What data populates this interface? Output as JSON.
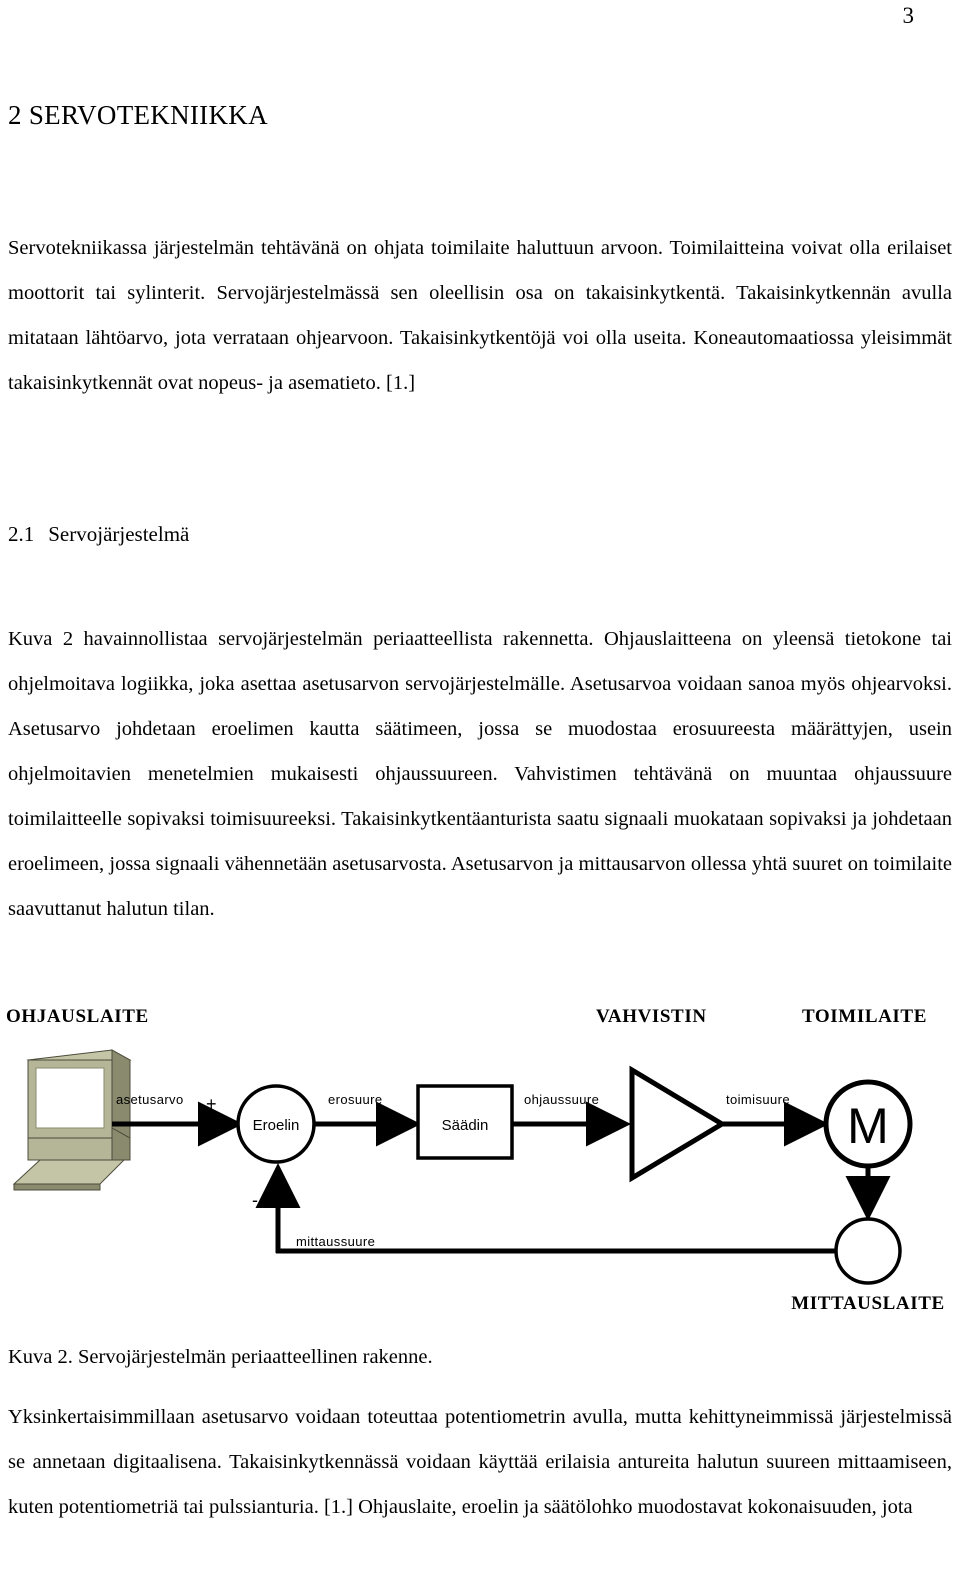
{
  "document": {
    "page_number": "3",
    "chapter_heading": "2 SERVOTEKNIIKKA",
    "section_heading_number": "2.1",
    "section_heading_title": "Servojärjestelmä",
    "paragraph_1": "Servotekniikassa järjestelmän tehtävänä on ohjata toimilaite haluttuun arvoon. Toimilaitteina voivat olla erilaiset moottorit tai sylinterit. Servojärjestelmässä sen oleellisin osa on takaisinkytkentä. Takaisinkytkennän avulla mitataan lähtöarvo, jota verrataan ohjearvoon. Takaisinkytkentöjä voi olla useita. Koneautomaatiossa yleisimmät takaisinkytkennät ovat nopeus- ja asematieto. [1.]",
    "paragraph_2": "Kuva 2 havainnollistaa servojärjestelmän periaatteellista rakennetta. Ohjauslaitteena on yleensä tietokone tai ohjelmoitava logiikka, joka asettaa asetusarvon servojärjestelmälle. Asetusarvoa voidaan sanoa myös ohjearvoksi. Asetusarvo johdetaan eroelimen kautta säätimeen, jossa se muodostaa erosuureesta määrättyjen, usein ohjelmoitavien menetelmien mukaisesti ohjaussuureen. Vahvistimen tehtävänä on muuntaa ohjaussuure toimilaitteelle sopivaksi toimisuureeksi. Takaisinkytkentäanturista saatu signaali muokataan sopivaksi ja johdetaan eroelimeen, jossa signaali vähennetään asetusarvosta. Asetusarvon ja mittausarvon ollessa yhtä suuret on toimilaite saavuttanut halutun tilan.",
    "figure_caption": "Kuva 2. Servojärjestelmän periaatteellinen rakenne.",
    "paragraph_4": "Yksinkertaisimmillaan asetusarvo voidaan toteuttaa potentiometrin avulla, mutta kehittyneimmissä järjestelmissä se annetaan digitaalisena. Takaisinkytkennässä voidaan käyttää erilaisia antureita halutun suureen mittaamiseen, kuten potentiometriä tai pulssianturia. [1.] Ohjauslaite, eroelin ja säätölohko muodostavat kokonaisuuden, jota"
  },
  "figure": {
    "block_labels": {
      "controller": "OHJAUSLAITE",
      "amplifier": "VAHVISTIN",
      "actuator": "TOIMILAITE",
      "sensor": "MITTAUSLAITE"
    },
    "node_labels": {
      "summing_junction": "Eroelin",
      "regulator": "Säädin",
      "motor": "M"
    },
    "signal_labels": {
      "setpoint": "asetusarvo",
      "error": "erosuure",
      "control": "ohjaussuure",
      "actuating": "toimisuure",
      "measurement": "mittaussuure"
    },
    "signs": {
      "plus": "+",
      "minus": "-"
    },
    "colors": {
      "stroke": "#000000",
      "computer_body": "#b5b597",
      "computer_top": "#c4c4a6",
      "computer_side": "#8a8a6e",
      "computer_screen": "#ffffff"
    }
  }
}
